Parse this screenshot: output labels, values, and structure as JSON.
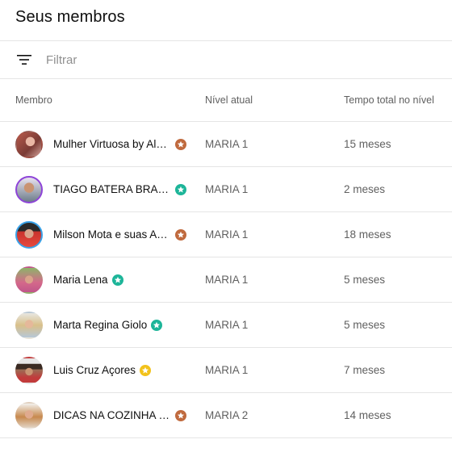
{
  "page": {
    "title": "Seus membros"
  },
  "filter": {
    "placeholder": "Filtrar",
    "icon": "filter-icon"
  },
  "columns": {
    "member": "Membro",
    "level": "Nível atual",
    "time": "Tempo total no nível"
  },
  "colors": {
    "bronze": "#c06a3e",
    "green": "#1db599",
    "gold": "#f2c21b"
  },
  "members": [
    {
      "name": "Mulher Virtuosa by Alex...",
      "badge": "bronze",
      "level": "MARIA 1",
      "time": "15 meses"
    },
    {
      "name": "TIAGO BATERA BRASIL ...",
      "badge": "green",
      "level": "MARIA 1",
      "time": "2 meses"
    },
    {
      "name": "Milson Mota e suas Ave...",
      "badge": "bronze",
      "level": "MARIA 1",
      "time": "18 meses"
    },
    {
      "name": "Maria Lena",
      "badge": "green",
      "level": "MARIA 1",
      "time": "5 meses"
    },
    {
      "name": "Marta Regina Giolo",
      "badge": "green",
      "level": "MARIA 1",
      "time": "5 meses"
    },
    {
      "name": "Luis Cruz Açores",
      "badge": "gold",
      "level": "MARIA 1",
      "time": "7 meses"
    },
    {
      "name": "DICAS NA COZINHA - S...",
      "badge": "bronze",
      "level": "MARIA 2",
      "time": "14 meses"
    }
  ]
}
